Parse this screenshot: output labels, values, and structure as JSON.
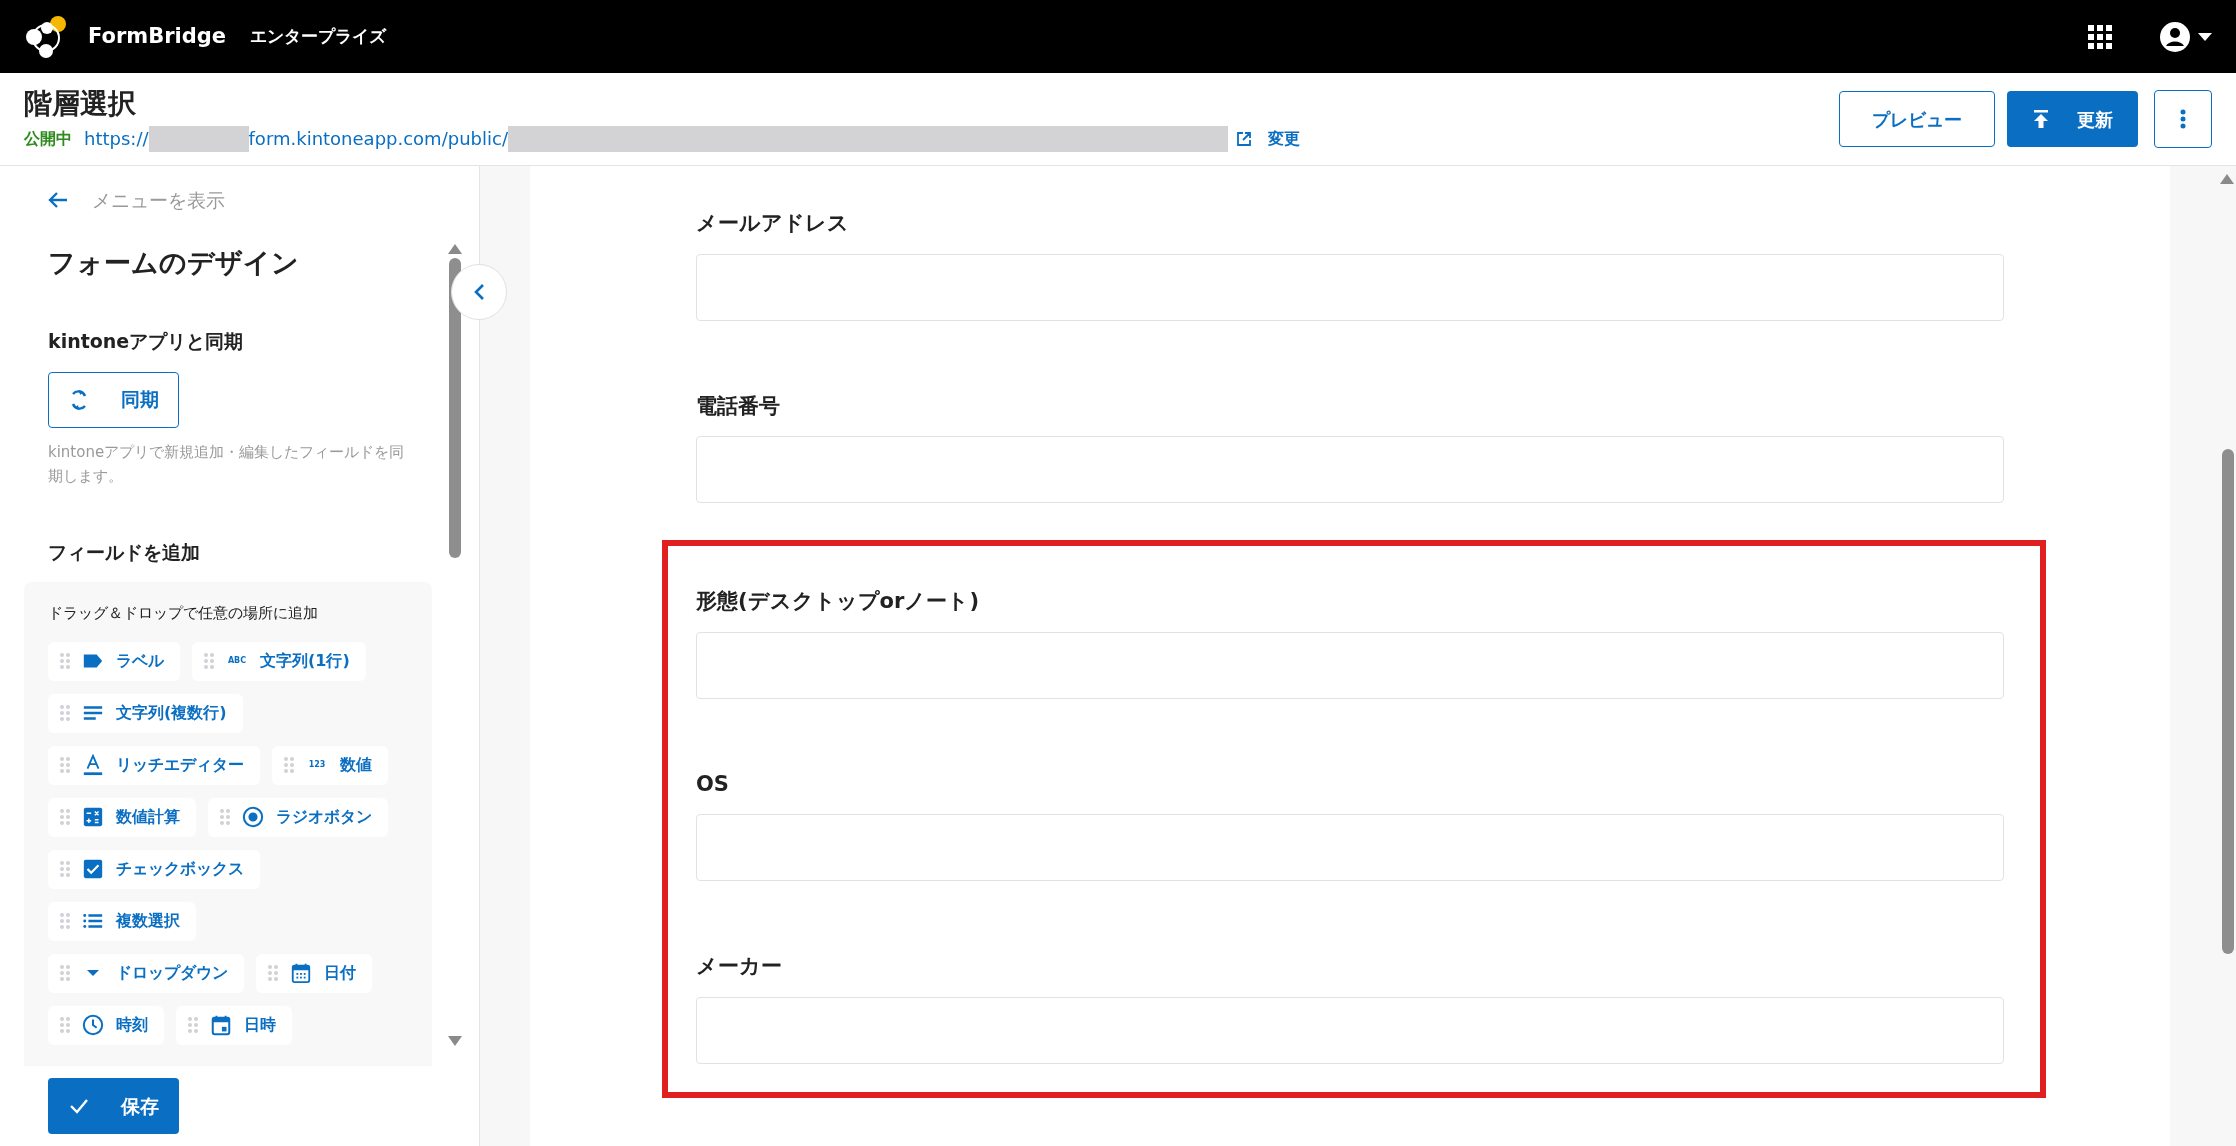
{
  "topbar": {
    "brand": "FormBridge",
    "edition": "エンタープライズ"
  },
  "header": {
    "title": "階層選択",
    "status": "公開中",
    "url_prefix": "https://",
    "url_middle": "form.kintoneapp.com/public/",
    "change_link": "変更",
    "buttons": [
      {
        "label": "プレビュー",
        "kind": "outline"
      },
      {
        "label": "更新",
        "kind": "primary"
      }
    ]
  },
  "sidebar": {
    "back_link": "メニューを表示",
    "heading": "フォームのデザイン",
    "sync_heading": "kintoneアプリと同期",
    "sync_button": "同期",
    "sync_note": "kintoneアプリで新規追加・編集したフィールドを同期します。",
    "add_heading": "フィールドを追加",
    "add_hint": "ドラッグ＆ドロップで任意の場所に追加",
    "chips": [
      [
        {
          "label": "ラベル",
          "kind": "label"
        },
        {
          "label": "文字列(1行)",
          "kind": "abc",
          "icon_text": "ABC"
        }
      ],
      [
        {
          "label": "文字列(複数行)",
          "kind": "lines"
        }
      ],
      [
        {
          "label": "リッチエディター",
          "kind": "rich"
        },
        {
          "label": "数値",
          "kind": "number",
          "icon_text": "123"
        }
      ],
      [
        {
          "label": "数値計算",
          "kind": "calc"
        },
        {
          "label": "ラジオボタン",
          "kind": "radio"
        }
      ],
      [
        {
          "label": "チェックボックス",
          "kind": "checkbox"
        }
      ],
      [
        {
          "label": "複数選択",
          "kind": "list"
        }
      ],
      [
        {
          "label": "ドロップダウン",
          "kind": "dropdown"
        },
        {
          "label": "日付",
          "kind": "date"
        }
      ],
      [
        {
          "label": "時刻",
          "kind": "time"
        },
        {
          "label": "日時",
          "kind": "datetime"
        }
      ]
    ],
    "save_button": "保存"
  },
  "form": {
    "sections": [
      {
        "highlighted": false,
        "fields": [
          {
            "label": "メールアドレス"
          },
          {
            "label": "電話番号"
          }
        ]
      },
      {
        "highlighted": true,
        "fields": [
          {
            "label": "形態(デスクトップorノート)"
          },
          {
            "label": "OS"
          },
          {
            "label": "メーカー"
          }
        ]
      }
    ]
  }
}
